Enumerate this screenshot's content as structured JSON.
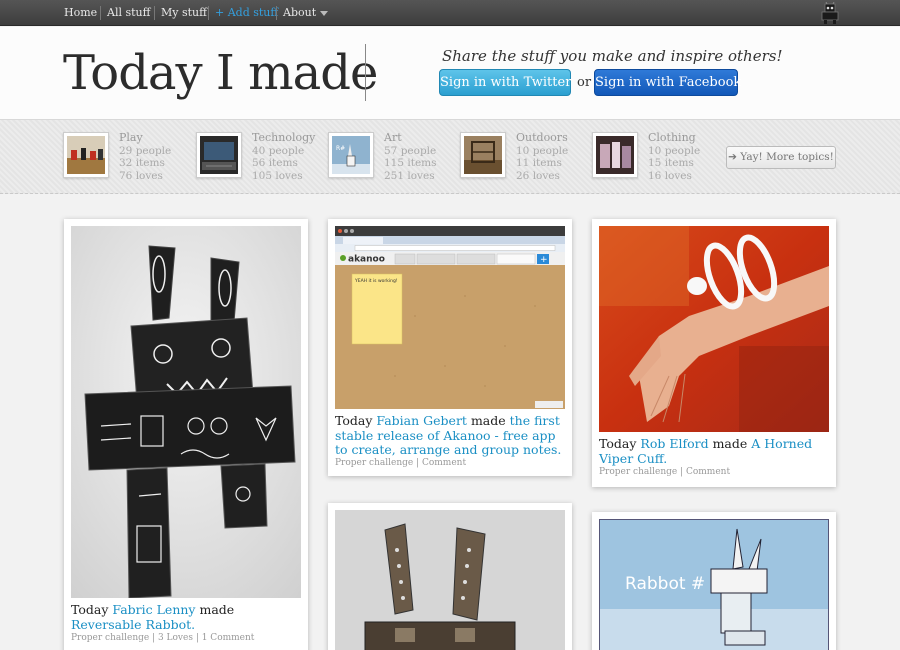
{
  "nav": {
    "home": "Home",
    "all_stuff": "All stuff",
    "my_stuff": "My stuff",
    "add_stuff": "+ Add stuff",
    "about": "About"
  },
  "header": {
    "title": "Today I made",
    "tagline": "Share the stuff you make and inspire others!",
    "twitter_button": "Sign in with Twitter",
    "or": "or",
    "facebook_button": "Sign in with Facebook"
  },
  "topics": [
    {
      "name": "Play",
      "people": "29 people",
      "items": "32 items",
      "loves": "76 loves"
    },
    {
      "name": "Technology",
      "people": "40 people",
      "items": "56 items",
      "loves": "105 loves"
    },
    {
      "name": "Art",
      "people": "57 people",
      "items": "115 items",
      "loves": "251 loves"
    },
    {
      "name": "Outdoors",
      "people": "10 people",
      "items": "11 items",
      "loves": "26 loves"
    },
    {
      "name": "Clothing",
      "people": "10 people",
      "items": "15 items",
      "loves": "16 loves"
    }
  ],
  "more_topics": "➔ Yay! More topics!",
  "cards": {
    "robot": {
      "today": "Today",
      "author": "Fabric Lenny",
      "made": "made",
      "item": "Reversable Rabbot.",
      "meta": "Proper challenge | 3 Loves | 1 Comment"
    },
    "akanoo": {
      "today": "Today",
      "author": "Fabian Gebert",
      "made": "made",
      "item": "the first stable release of Akanoo - free app to create, arrange and group notes.",
      "meta": "Proper challenge | Comment",
      "screenshot_brand": "akanoo",
      "sticky_note": "YEAH it is working!"
    },
    "cuff": {
      "today": "Today",
      "author": "Rob Elford",
      "made": "made",
      "item": "A Horned Viper Cuff.",
      "meta": "Proper challenge | Comment"
    },
    "rabbot_art": {
      "drawing_text": "Rabbot # 3"
    }
  },
  "colors": {
    "link": "#1a8fc4",
    "nav_accent": "#33a0e0",
    "twitter": "#3aaee0",
    "facebook": "#1a66c8"
  }
}
